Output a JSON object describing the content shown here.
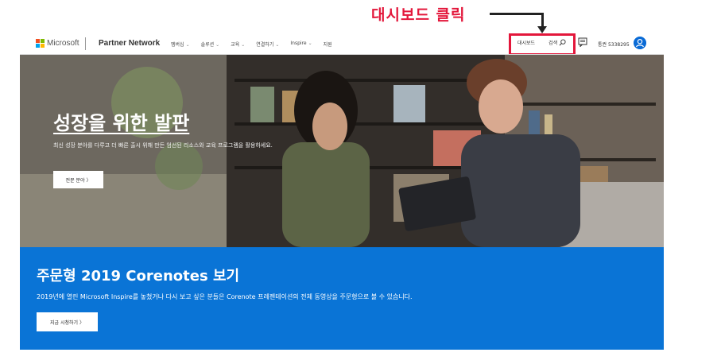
{
  "annotation": {
    "text": "대시보드 클릭",
    "color": "#e3173b"
  },
  "header": {
    "logo_text": "Microsoft",
    "logo_colors": [
      "#f25022",
      "#7fba00",
      "#00a4ef",
      "#ffb900"
    ],
    "brand": "Partner Network",
    "nav": [
      {
        "label": "멤버십",
        "chevron": "⌄"
      },
      {
        "label": "솔루션",
        "chevron": "⌄"
      },
      {
        "label": "교육",
        "chevron": "⌄"
      },
      {
        "label": "연결하기",
        "chevron": "⌄"
      },
      {
        "label": "Inspire",
        "chevron": "⌄"
      },
      {
        "label": "지원",
        "chevron": ""
      }
    ],
    "dashboard_label": "대시보드",
    "search_label": "검색",
    "account_id": "통권 5338295",
    "icons": {
      "search": "search-icon",
      "chat": "chat-icon",
      "avatar": "person-icon"
    }
  },
  "hero": {
    "title": "성장을 위한 발판",
    "description": "최신 성장 분야를 다루고 더 빠른 출시 위해 만든 엄선된 리소스와 교육 프로그램을 활용하세요.",
    "button": "전문 분야 〉"
  },
  "banner": {
    "title": "주문형 2019 Corenotes 보기",
    "description": "2019년에 열린 Microsoft Inspire를 놓쳤거나 다시 보고 싶은 분들은 Corenote 프레젠테이션의 전체 동영상을 주문형으로 볼 수 있습니다.",
    "button": "지금 시청하기 〉",
    "color": "#0a74d6"
  }
}
